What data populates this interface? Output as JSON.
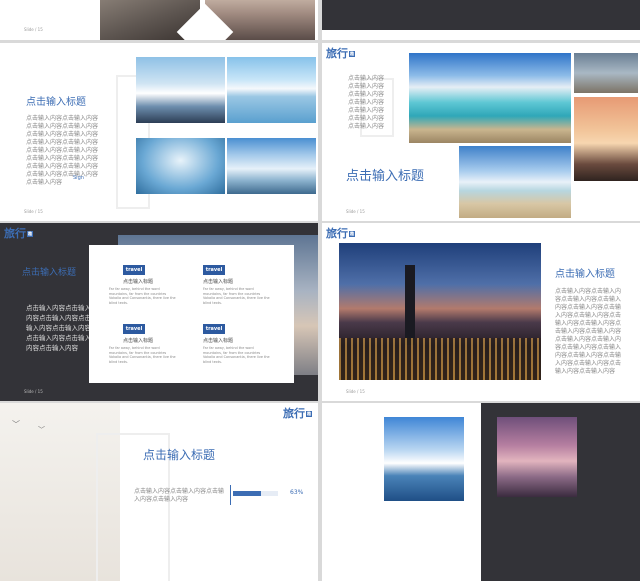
{
  "slides": {
    "s1": {
      "slide_num": "Slide / 15"
    },
    "s2": {
      "slide_num": ""
    },
    "s3": {
      "title": "点击输入标题",
      "body": "点击输入内容点击输入内容点击输入内容点击输入内容点击输入内容点击输入内容点击输入内容点击输入内容点击输入内容点击输入内容点击输入内容点击输入内容点击输入内容点击输入内容点击输入内容点击输入内容点击输入内容",
      "sign": "Sign",
      "slide_num": "Slide / 15"
    },
    "s4": {
      "logo": "旅行",
      "logo_tag": "趣",
      "title": "点击输入标题",
      "lines": [
        "点击输入内容",
        "点击输入内容",
        "点击输入内容",
        "点击输入内容",
        "点击输入内容",
        "点击输入内容",
        "点击输入内容"
      ],
      "slide_num": "Slide / 15"
    },
    "s5": {
      "logo": "旅行",
      "logo_tag": "趣",
      "title": "点击输入标题",
      "body": "点击输入内容点击输入内容点击输入内容点击输入内容点击输入内容点击输入内容点击输入内容点击输入内容",
      "slide_num": "Slide / 15",
      "cards": [
        {
          "logo": "travel",
          "title": "点击输入标题",
          "text": "Far far away, behind the word mountains, far from the countries Vokalia and Consonantia, there live the blind texts."
        },
        {
          "logo": "travel",
          "title": "点击输入标题",
          "text": "Far far away, behind the word mountains, far from the countries Vokalia and Consonantia, there live the blind texts."
        },
        {
          "logo": "travel",
          "title": "点击输入标题",
          "text": "Far far away, behind the word mountains, far from the countries Vokalia and Consonantia, there live the blind texts."
        },
        {
          "logo": "travel",
          "title": "点击输入标题",
          "text": "Far far away, behind the word mountains, far from the countries Vokalia and Consonantia, there live the blind texts."
        }
      ]
    },
    "s6": {
      "logo": "旅行",
      "logo_tag": "趣",
      "title": "点击输入标题",
      "body": "点击输入内容点击输入内容点击输入内容点击输入内容点击输入内容点击输入内容点击输入内容点击输入内容点击输入内容点击输入内容点击输入内容点击输入内容点击输入内容点击输入内容点击输入内容点击输入内容点击输入内容点击输入内容点击输入内容点击输入内容",
      "slide_num": "Slide / 15"
    },
    "s7": {
      "logo": "旅行",
      "logo_tag": "趣",
      "title": "点击输入标题",
      "body": "点击输入内容点击输入内容点击输入内容点击输入内容",
      "progress_label": "63%",
      "progress": 0.63
    },
    "s8": {}
  },
  "colors": {
    "accent": "#3c6db4",
    "dark": "#333338"
  }
}
